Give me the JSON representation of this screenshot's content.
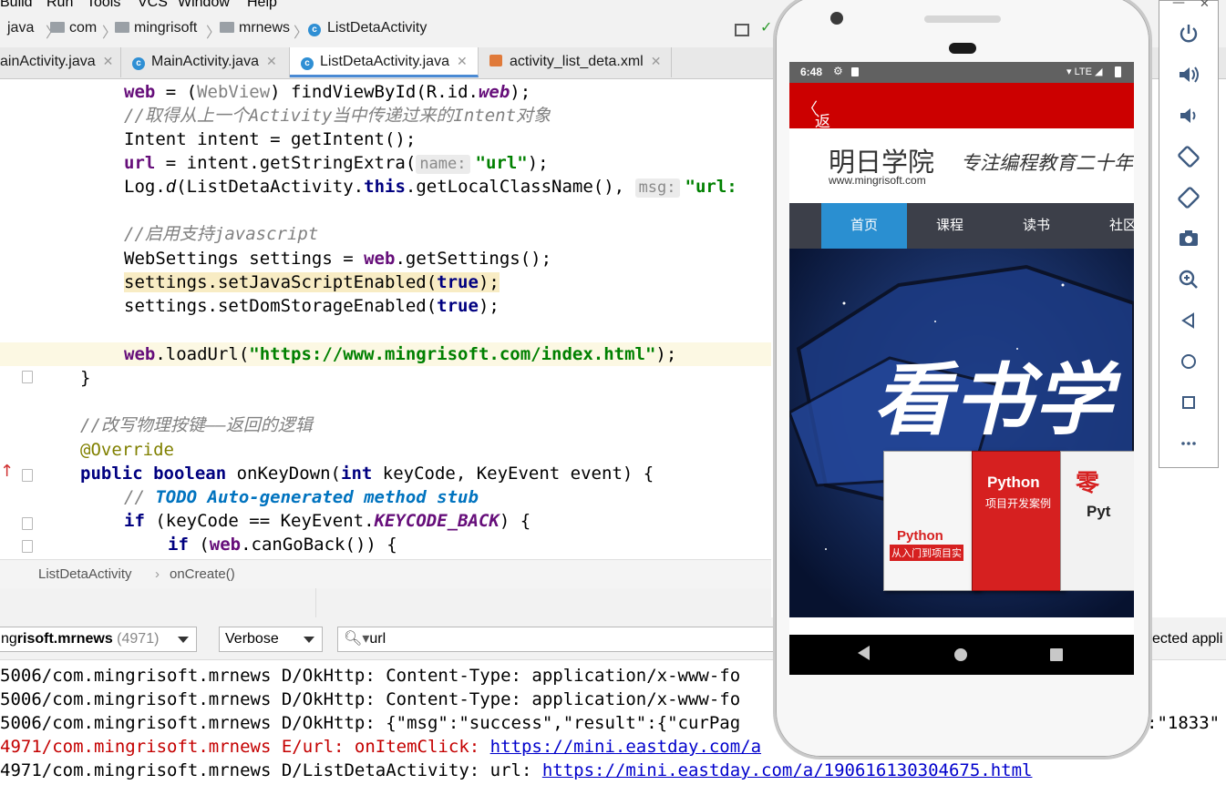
{
  "menu": [
    "Build",
    "Run",
    "Tools",
    "VCS",
    "Window",
    "Help"
  ],
  "breadcrumb": [
    "java",
    "com",
    "mingrisoft",
    "mrnews",
    "ListDetaActivity"
  ],
  "tabs": [
    {
      "label": "ainActivity.java",
      "active": false
    },
    {
      "label": "MainActivity.java",
      "active": false
    },
    {
      "label": "ListDetaActivity.java",
      "active": true
    },
    {
      "label": "activity_list_deta.xml",
      "active": false
    }
  ],
  "code": {
    "l1_a": "web",
    "l1_b": " = (",
    "l1_c": "WebView",
    "l1_d": ") findViewById(R.id.",
    "l1_e": "web",
    "l1_f": ");",
    "l2": "//取得从上一个Activity当中传递过来的Intent对象",
    "l3": "Intent intent = getIntent();",
    "l4_a": "url",
    "l4_b": " = intent.getStringExtra(",
    "l4_hint": "name:",
    "l4_str": "\"url\"",
    "l4_c": ");",
    "l5_a": "Log.",
    "l5_b": "d",
    "l5_c": "(ListDetaActivity.",
    "l5_kw": "this",
    "l5_d": ".getLocalClassName(), ",
    "l5_hint": "msg:",
    "l5_str": "\"url:",
    "l6": "//启用支持javascript",
    "l7_a": "WebSettings settings = ",
    "l7_b": "web",
    "l7_c": ".getSettings();",
    "l8_a": "settings.setJavaScriptEnabled(",
    "l8_kw": "true",
    "l8_b": ");",
    "l9_a": "settings.setDomStorageEnabled(",
    "l9_kw": "true",
    "l9_b": ");",
    "l10_a": "web",
    "l10_b": ".loadUrl(",
    "l10_str": "\"https://www.mingrisoft.com/index.html\"",
    "l10_c": ");",
    "l11": "}",
    "l12": "//改写物理按键——返回的逻辑",
    "l13": "@Override",
    "l14_kw1": "public",
    "l14_kw2": "boolean",
    "l14_a": " onKeyDown(",
    "l14_kw3": "int",
    "l14_b": " keyCode, KeyEvent event) {",
    "l15_a": "// ",
    "l15_todo": "TODO Auto-generated method stub",
    "l16_kw": "if",
    "l16_a": " (keyCode == KeyEvent.",
    "l16_const": "KEYCODE_BACK",
    "l16_b": ") {",
    "l17_kw": "if",
    "l17_a": " (",
    "l17_fld": "web",
    "l17_b": ".canGoBack()) {"
  },
  "editor_breadcrumb": [
    "ListDetaActivity",
    "onCreate()"
  ],
  "logcat": {
    "process": "risoft.mrnews",
    "process_prefix": "ng",
    "process_pid": "(4971)",
    "level": "Verbose",
    "filter": "url",
    "right_label": "ected appli",
    "lines": [
      {
        "text": "5006/com.mingrisoft.mrnews D/OkHttp: Content-Type: application/x-www-fo",
        "error": false
      },
      {
        "text": "5006/com.mingrisoft.mrnews D/OkHttp: Content-Type: application/x-www-fo",
        "error": false
      },
      {
        "text": "5006/com.mingrisoft.mrnews D/OkHttp: {\"msg\":\"success\",\"result\":{\"curPag",
        "tail": ":\"1833\"",
        "error": false
      },
      {
        "text": "4971/com.mingrisoft.mrnews E/url: onItemClick: ",
        "link": "https://mini.eastday.com/a",
        "error": true
      },
      {
        "text": "4971/com.mingrisoft.mrnews D/ListDetaActivity: url: ",
        "link": "https://mini.eastday.com/a/190616130304675.html",
        "error": false
      }
    ]
  },
  "phone": {
    "time": "6:48",
    "network": "LTE",
    "back_label": "返回",
    "brand_title": "明日学院",
    "brand_slogan": "专注编程教育二十年",
    "brand_url": "www.mingrisoft.com",
    "nav": [
      "首页",
      "课程",
      "读书",
      "社区"
    ],
    "banner_title": "看书学",
    "books": [
      {
        "title": "Python",
        "subtitle": "从入门到项目实",
        "color": "#ffffff"
      },
      {
        "title": "Python",
        "subtitle": "项目开发案例",
        "color": "#d62020"
      },
      {
        "title": "零",
        "subtitle": "Pyt",
        "color": "#ffffff"
      }
    ]
  },
  "colors": {
    "accent": "#cc0000",
    "nav_active": "#2a8fd1",
    "keyword": "#000080",
    "field": "#660e7a",
    "string": "#008000",
    "comment": "#808080"
  }
}
